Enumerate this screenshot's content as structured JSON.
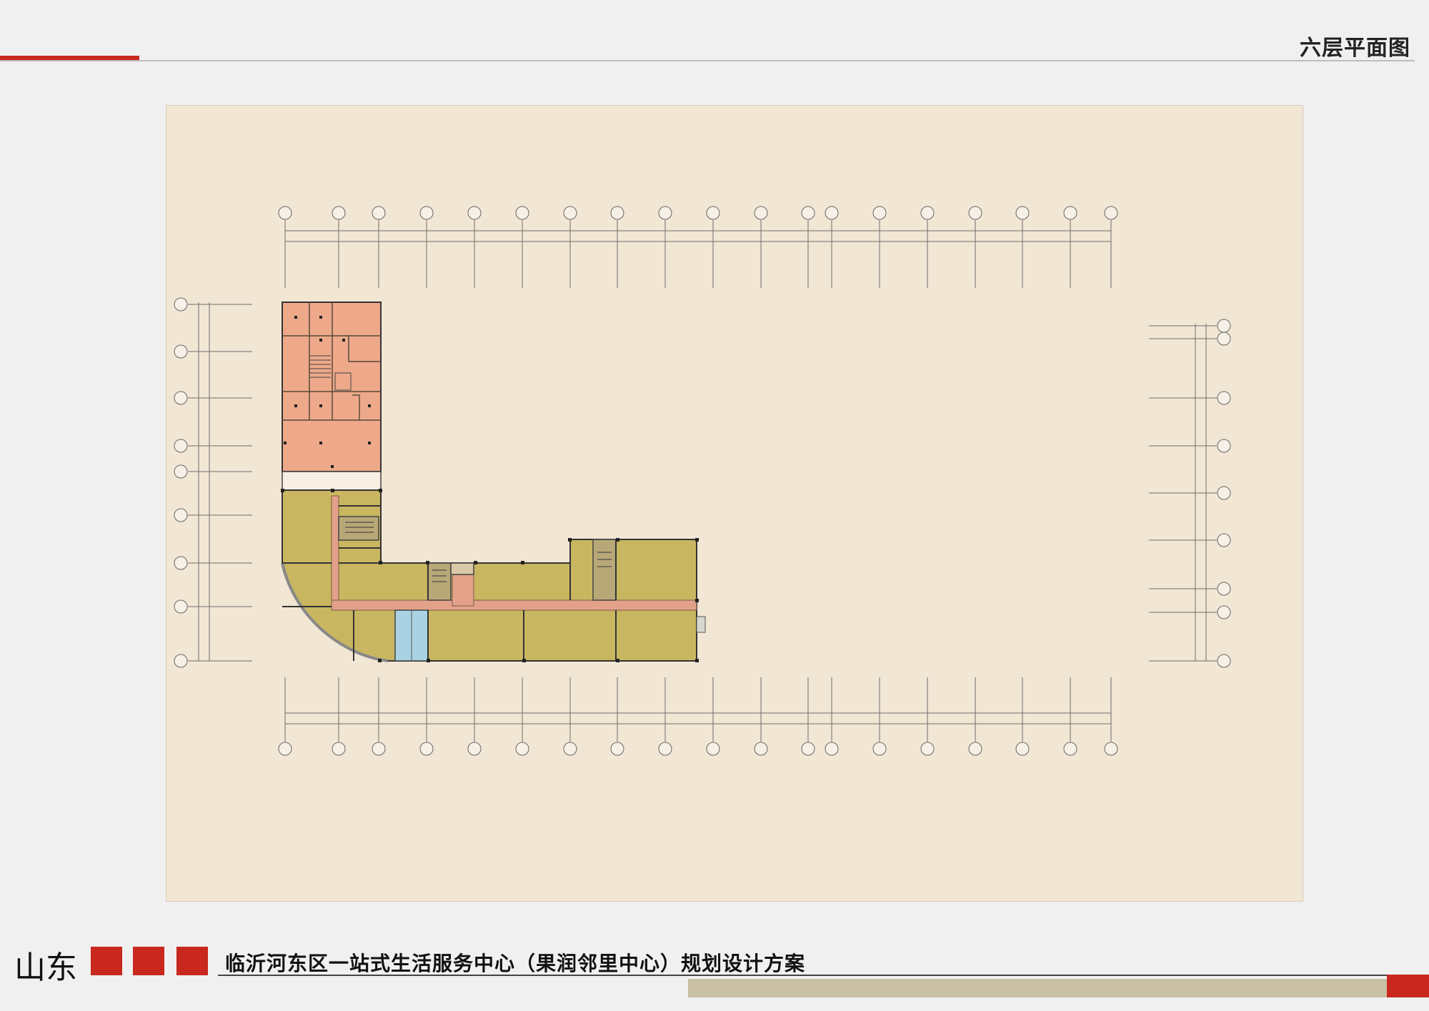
{
  "header": {
    "title": "六层平面图"
  },
  "footer": {
    "brand": "山东",
    "project_title": "临沂河东区一站式生活服务中心（果润邻里中心）规划设计方案"
  },
  "colors": {
    "accent_red": "#c8281e",
    "sheet_background": "#f2e6d4",
    "office_zone": "#eda98a",
    "commercial_zone": "#c9b660",
    "corridor": "#e3a18a",
    "core": "#b8a878",
    "elevator": "#a9d3e3"
  },
  "icons": {
    "grid_axis_bubble": "circle-with-label"
  }
}
